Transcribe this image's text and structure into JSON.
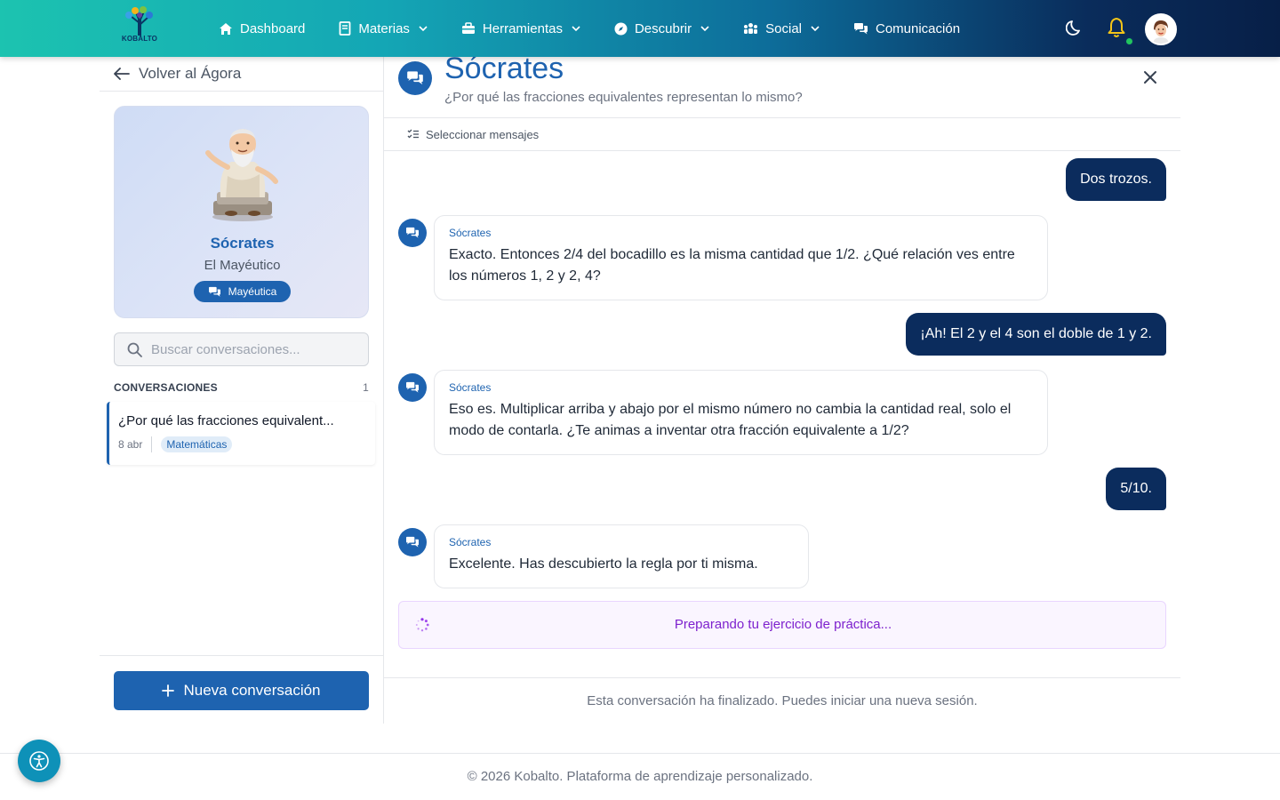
{
  "brand": {
    "logo_text": "KOBALTO"
  },
  "nav": {
    "items": [
      {
        "label": "Dashboard",
        "icon": "home-icon"
      },
      {
        "label": "Materias",
        "icon": "book-icon",
        "dropdown": true
      },
      {
        "label": "Herramientas",
        "icon": "toolbox-icon",
        "dropdown": true
      },
      {
        "label": "Descubrir",
        "icon": "compass-icon",
        "dropdown": true
      },
      {
        "label": "Social",
        "icon": "users-icon",
        "dropdown": true
      },
      {
        "label": "Comunicación",
        "icon": "comments-icon"
      }
    ]
  },
  "sidebar": {
    "back_label": "Volver al Ágora",
    "tutor": {
      "name": "Sócrates",
      "title": "El Mayéutico",
      "badge": "Mayéutica"
    },
    "search_placeholder": "Buscar conversaciones...",
    "conversations_label": "CONVERSACIONES",
    "conversations_count": "1",
    "conversations": [
      {
        "title": "¿Por qué las fracciones equivalent...",
        "date": "8 abr",
        "tag": "Matemáticas"
      }
    ],
    "new_conversation_label": "Nueva conversación"
  },
  "chat": {
    "title": "Sócrates",
    "subtitle": "¿Por qué las fracciones equivalentes representan lo mismo?",
    "select_messages_label": "Seleccionar mensajes",
    "messages": [
      {
        "role": "user",
        "text": "Dos trozos."
      },
      {
        "role": "bot",
        "sender": "Sócrates",
        "text": "Exacto. Entonces 2/4 del bocadillo es la misma cantidad que 1/2. ¿Qué relación ves entre los números 1, 2 y 2, 4?"
      },
      {
        "role": "user",
        "text": "¡Ah! El 2 y el 4 son el doble de 1 y 2."
      },
      {
        "role": "bot",
        "sender": "Sócrates",
        "text": "Eso es. Multiplicar arriba y abajo por el mismo número no cambia la cantidad real, solo el modo de contarla. ¿Te animas a inventar otra fracción equivalente a 1/2?"
      },
      {
        "role": "user",
        "text": "5/10."
      },
      {
        "role": "bot",
        "sender": "Sócrates",
        "text": "Excelente. Has descubierto la regla por ti misma."
      }
    ],
    "practice_status": "Preparando tu ejercicio de práctica...",
    "ended_notice": "Esta conversación ha finalizado. Puedes iniciar una nueva sesión."
  },
  "footer": {
    "text": "© 2026 Kobalto. Plataforma de aprendizaje personalizado."
  },
  "colors": {
    "primary": "#1e63b0",
    "user_bubble": "#0b2c5d",
    "practice_text": "#7e22ce",
    "online": "#22c55e"
  }
}
